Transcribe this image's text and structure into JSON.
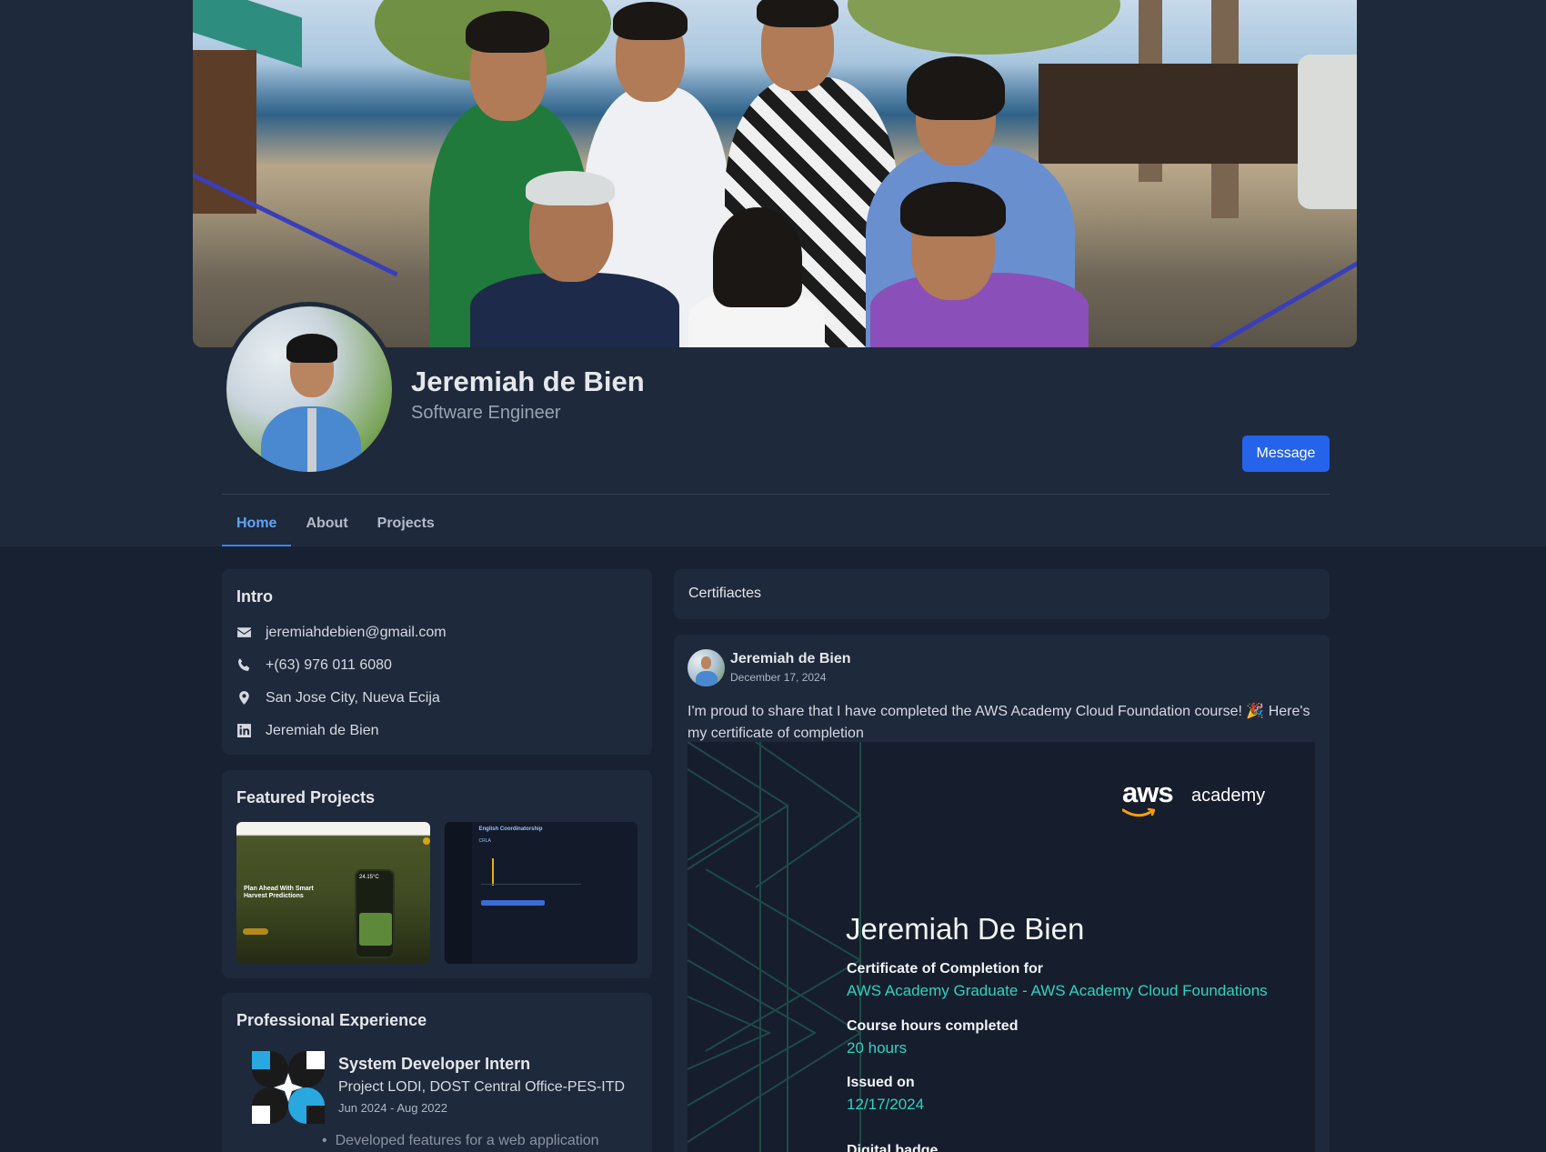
{
  "profile": {
    "name": "Jeremiah de Bien",
    "role": "Software Engineer",
    "message_button": "Message"
  },
  "tabs": [
    {
      "label": "Home",
      "active": true
    },
    {
      "label": "About",
      "active": false
    },
    {
      "label": "Projects",
      "active": false
    }
  ],
  "intro": {
    "title": "Intro",
    "items": [
      {
        "icon": "envelope-icon",
        "text": "jeremiahdebien@gmail.com"
      },
      {
        "icon": "phone-icon",
        "text": "+(63) 976 011 6080"
      },
      {
        "icon": "location-pin-icon",
        "text": "San Jose City, Nueva Ecija"
      },
      {
        "icon": "linkedin-icon",
        "text": "Jeremiah de Bien"
      }
    ]
  },
  "featured": {
    "title": "Featured Projects",
    "projects": [
      {
        "heading": "Plan Ahead With Smart Harvest Predictions",
        "temp": "24.15°C"
      },
      {
        "heading": "English Coordinatorship",
        "sub": "CRLA"
      }
    ]
  },
  "experience": {
    "title": "Professional Experience",
    "items": [
      {
        "title": "System Developer Intern",
        "org": "Project LODI, DOST Central Office-PES-ITD",
        "dates": "Jun 2024 - Aug 2022",
        "bullet": "Developed features for a web application"
      }
    ]
  },
  "certificates": {
    "header": "Certifiactes",
    "post": {
      "author": "Jeremiah de Bien",
      "date": "December 17, 2024",
      "text": "I'm proud to share that I have completed the AWS Academy Cloud Foundation course! 🎉 Here's my certificate of completion",
      "certificate": {
        "brand": "aws",
        "brand_sub": "academy",
        "recipient": "Jeremiah De Bien",
        "completion_label": "Certificate of Completion for",
        "completion_value": "AWS Academy Graduate - AWS Academy Cloud Foundations",
        "hours_label": "Course hours completed",
        "hours_value": "20 hours",
        "issued_label": "Issued on",
        "issued_value": "12/17/2024",
        "badge_label": "Digital badge"
      }
    }
  },
  "colors": {
    "accent": "#2563eb",
    "tab_active": "#60a5fa",
    "card_bg": "#1e293b",
    "page_bg": "#182131",
    "cert_teal": "#2dd4bf"
  }
}
